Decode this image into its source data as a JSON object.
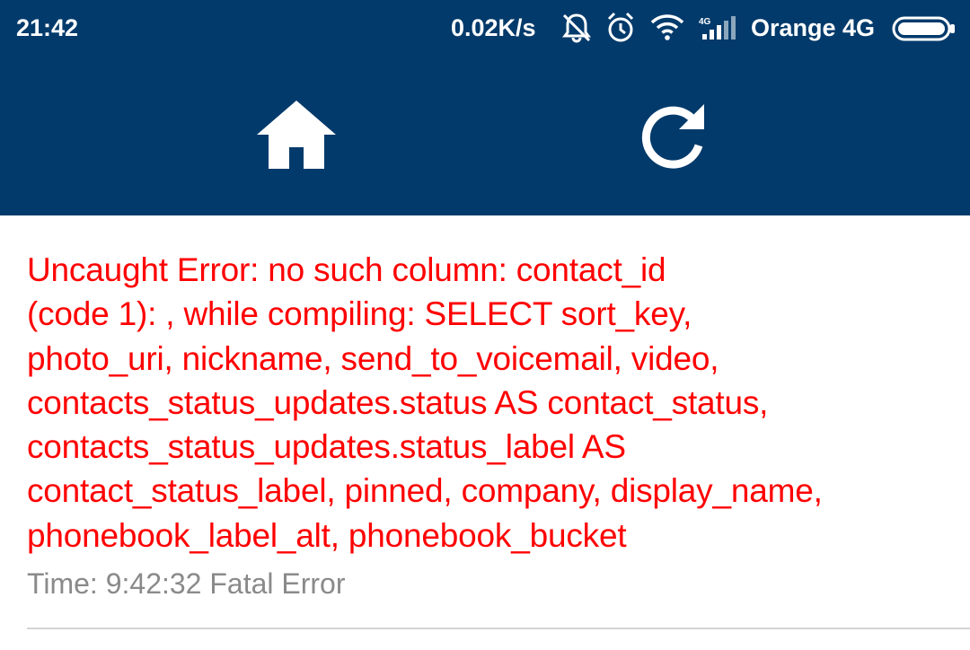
{
  "status_bar": {
    "time": "21:42",
    "network_speed": "0.02K/s",
    "carrier": "Orange 4G",
    "icons": [
      "bell-muted-icon",
      "alarm-icon",
      "wifi-icon",
      "signal-icon",
      "battery-icon"
    ]
  },
  "toolbar": {
    "color": "#023a6b",
    "home_icon": "home-icon",
    "refresh_icon": "refresh-icon"
  },
  "error": {
    "message": "Uncaught Error: no such column: contact_id\n(code 1): , while compiling: SELECT sort_key,\nphoto_uri, nickname, send_to_voicemail, video,\ncontacts_status_updates.status AS contact_status,\ncontacts_status_updates.status_label AS\ncontact_status_label, pinned, company, display_name,\nphonebook_label_alt, phonebook_bucket",
    "meta": "Time: 9:42:32 Fatal Error",
    "color": "#ff0000"
  }
}
